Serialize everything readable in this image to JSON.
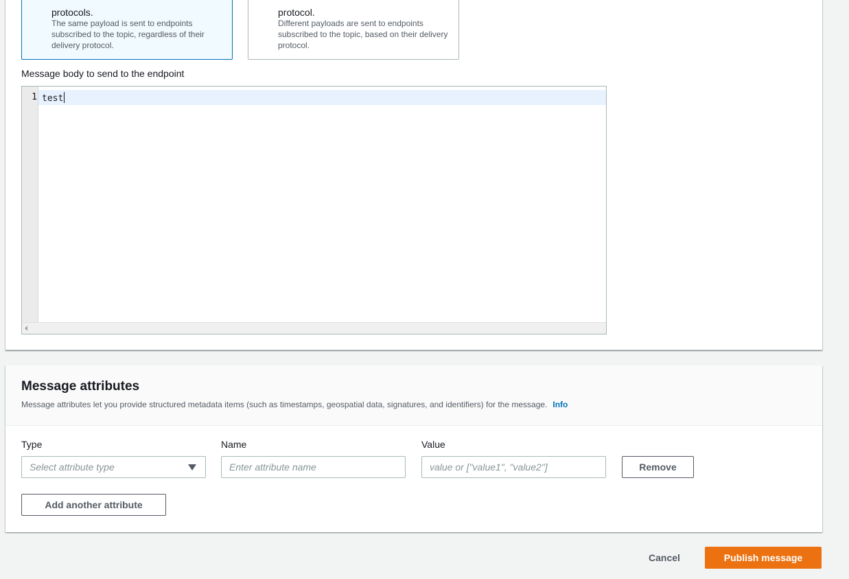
{
  "payload_options": [
    {
      "title": "protocols.",
      "description": "The same payload is sent to endpoints subscribed to the topic, regardless of their delivery protocol.",
      "selected": true
    },
    {
      "title": "protocol.",
      "description": "Different payloads are sent to endpoints subscribed to the topic, based on their delivery protocol.",
      "selected": false
    }
  ],
  "message_body": {
    "label": "Message body to send to the endpoint",
    "lines": [
      {
        "number": "1",
        "text": "test"
      }
    ]
  },
  "message_attributes": {
    "title": "Message attributes",
    "description": "Message attributes let you provide structured metadata items (such as timestamps, geospatial data, signatures, and identifiers) for the message.",
    "info_link": "Info",
    "columns": {
      "type": "Type",
      "name": "Name",
      "value": "Value"
    },
    "type_placeholder": "Select attribute type",
    "name_placeholder": "Enter attribute name",
    "value_placeholder": "value or [\"value1\", \"value2\"]",
    "remove_label": "Remove",
    "add_label": "Add another attribute"
  },
  "footer": {
    "cancel_label": "Cancel",
    "publish_label": "Publish message"
  },
  "colors": {
    "primary": "#ec7211",
    "link": "#0073bb",
    "selected_border": "#0073bb",
    "selected_bg": "#f1faff"
  }
}
